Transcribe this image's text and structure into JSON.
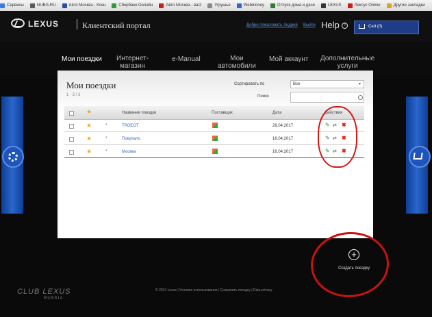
{
  "bookmarks": [
    {
      "label": "Сервисы",
      "color": "#3b7ddb"
    },
    {
      "label": "NUBG.RU",
      "color": "#5a5a5a"
    },
    {
      "label": "Авто Москва - Ксен",
      "color": "#2a4fa0"
    },
    {
      "label": "Сбербанк Онлайн",
      "color": "#2e9a3a"
    },
    {
      "label": "Авто Москва - ва/2",
      "color": "#c42020"
    },
    {
      "label": "Угрушье",
      "color": "#8a8a8a"
    },
    {
      "label": "Webmoney",
      "color": "#2b6acb"
    },
    {
      "label": "Отпуск дома и даче",
      "color": "#2e7d32"
    },
    {
      "label": "LEXUS",
      "color": "#333333"
    },
    {
      "label": "Лексус Online",
      "color": "#c42020"
    },
    {
      "label": "Другие закладки",
      "color": "#d9a520"
    }
  ],
  "header": {
    "brand": "LEXUS",
    "portal_title": "Клиентский портал",
    "welcome": "Добро пожаловать Андрей",
    "logout": "Выйти",
    "help": "Help",
    "help_mark": "?",
    "cart_label": "Cart (0)"
  },
  "nav": {
    "trips": "Мои поездки",
    "stores": "Интернет-\nмагазин",
    "manual": "e-Manual",
    "cars": "Мои\nавтомобили",
    "account": "Мой аккаунт",
    "services": "Дополнительные\nуслуги"
  },
  "panel": {
    "title": "Мои поездки",
    "pager": "1 - 3 / 3",
    "sort_label": "Сортировать по",
    "sort_value": "Все",
    "sort_arrow": "▾",
    "search_label": "Поиск",
    "search_value": "",
    "columns": {
      "name": "Название поездки",
      "provider": "Поставщик",
      "date": "Дата",
      "actions": "Действия"
    },
    "rows": [
      {
        "name": "ТРОЕОТ",
        "date": "28.04.2017"
      },
      {
        "name": "Покупало",
        "date": "16.04.2017"
      },
      {
        "name": "Москва",
        "date": "16.04.2017"
      }
    ],
    "star_glyph": "★",
    "dot_glyph": "•",
    "edit_glyph": "✎",
    "copy_glyph": "⇄",
    "delete_glyph": "✖"
  },
  "create_trip": {
    "plus": "+",
    "label": "Создать поездку"
  },
  "footer": {
    "text": "© 2014 Lexus | Условия использования | Сохранить поездку | Data privacy",
    "club_logo": "CLUB LEXUS",
    "club_sub": "RUSSIA"
  },
  "colors": {
    "accent_blue": "#1e3d86",
    "link_blue": "#5a8fe0",
    "annotation_red": "#d41414",
    "star_orange": "#f0a81c"
  }
}
